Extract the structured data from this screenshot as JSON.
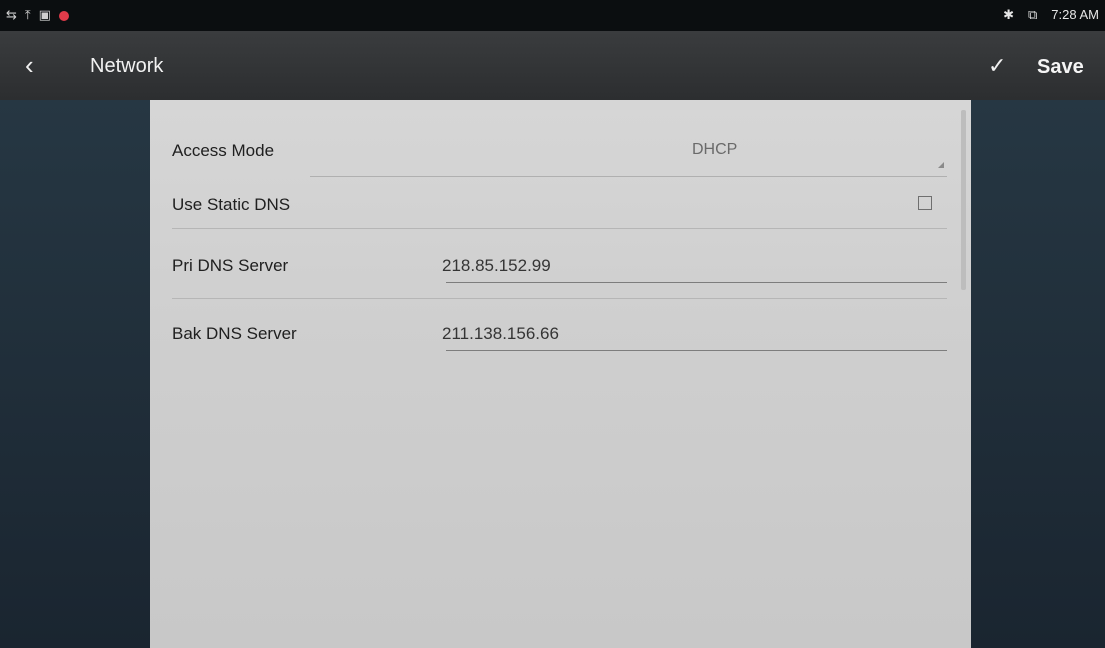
{
  "status_bar": {
    "left_icons": [
      "usb-icon",
      "upload-icon",
      "image-icon",
      "record-icon"
    ],
    "bluetooth_icon": "bluetooth-icon",
    "cast_icon": "screen-cast-icon",
    "time": "7:28 AM"
  },
  "app_bar": {
    "back_icon": "back-chevron-icon",
    "title": "Network",
    "confirm_icon": "checkmark-icon",
    "save_label": "Save"
  },
  "form": {
    "access_mode": {
      "label": "Access Mode",
      "value": "DHCP"
    },
    "static_dns": {
      "label": "Use Static DNS",
      "checked": false
    },
    "pri_dns": {
      "label": "Pri DNS Server",
      "value": "218.85.152.99"
    },
    "bak_dns": {
      "label": "Bak DNS Server",
      "value": "211.138.156.66"
    }
  },
  "colors": {
    "status_bar": "#0b0e10",
    "app_bar": "#333537",
    "side_panel": "#22313c",
    "card": "#d1d1d1",
    "notification_accent": "#e23b4a"
  }
}
